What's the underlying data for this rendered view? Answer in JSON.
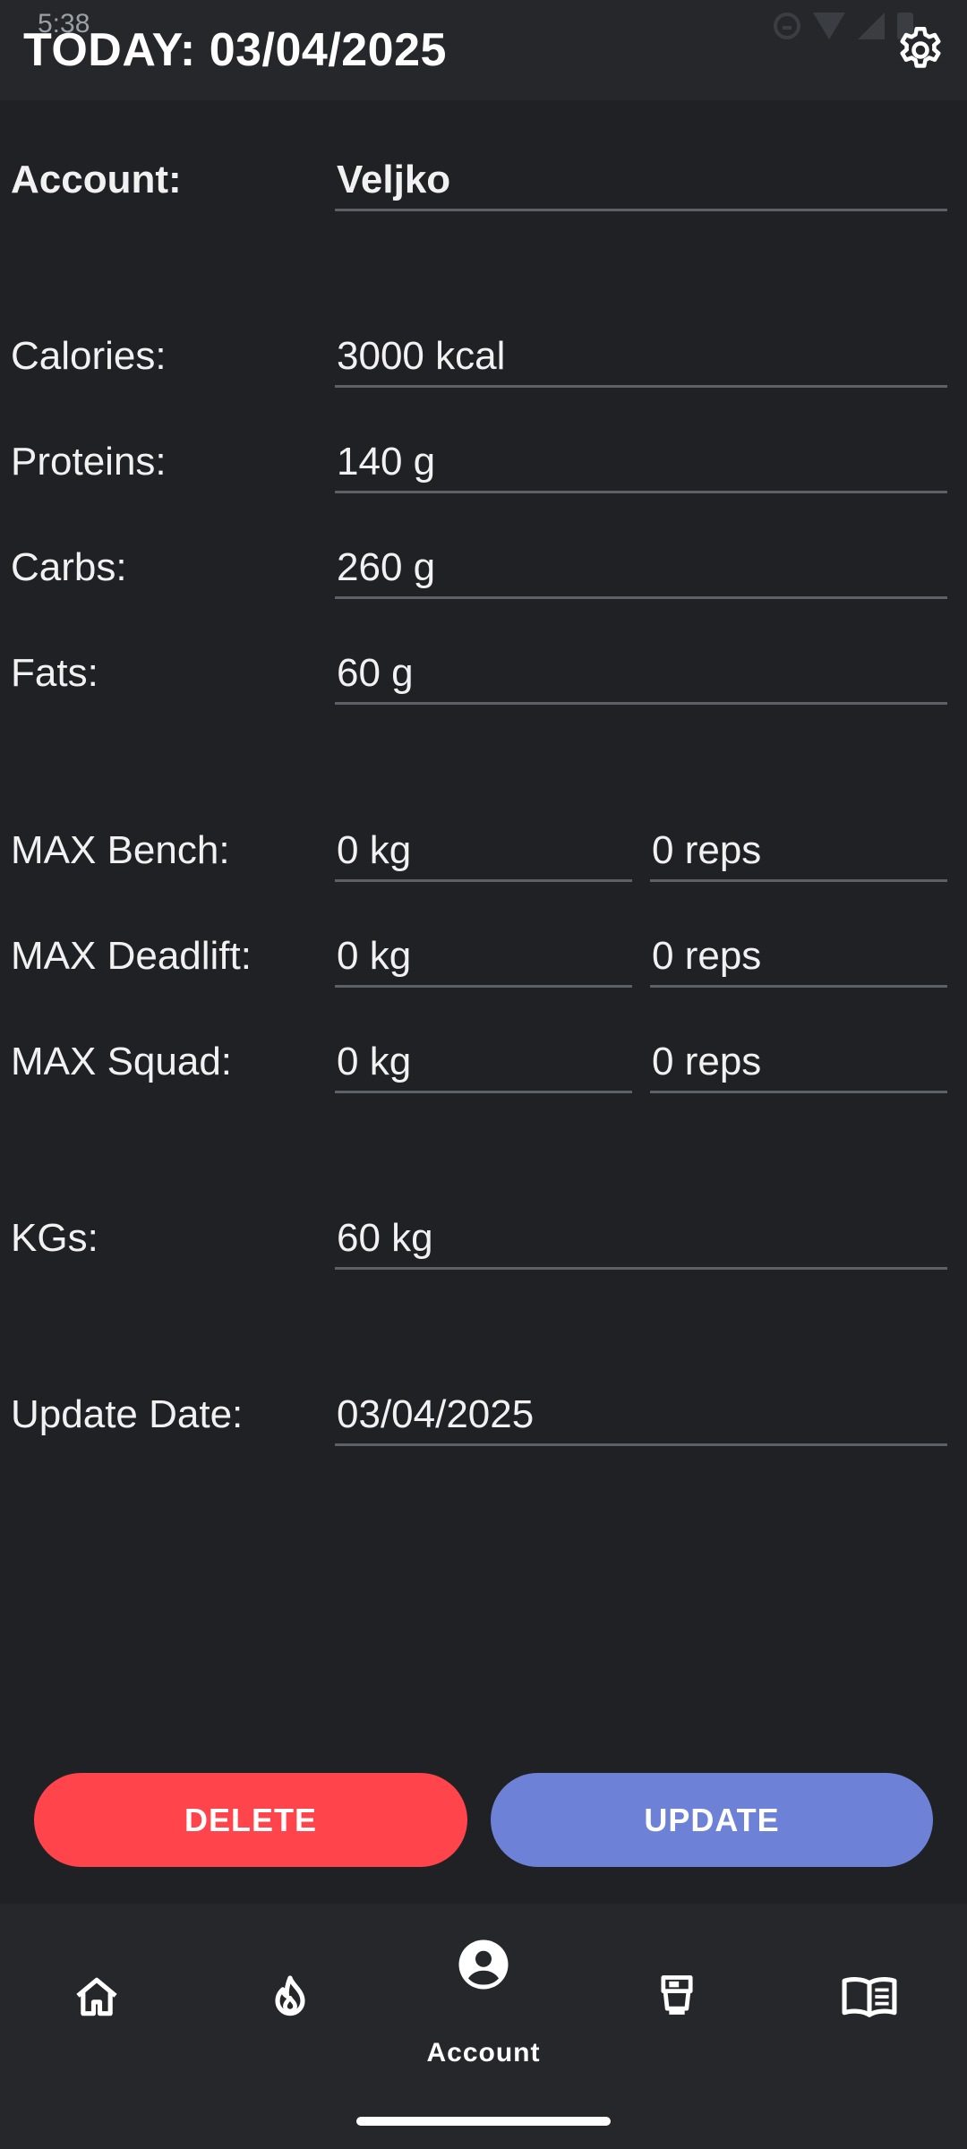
{
  "status_bar": {
    "time": "5:38"
  },
  "header": {
    "title": "TODAY: 03/04/2025"
  },
  "form": {
    "account": {
      "label": "Account:",
      "value": "Veljko"
    },
    "calories": {
      "label": "Calories:",
      "value": "3000 kcal"
    },
    "proteins": {
      "label": "Proteins:",
      "value": "140 g"
    },
    "carbs": {
      "label": "Carbs:",
      "value": "260 g"
    },
    "fats": {
      "label": "Fats:",
      "value": "60 g"
    },
    "max_bench": {
      "label": "MAX Bench:",
      "kg": "0 kg",
      "reps": "0 reps"
    },
    "max_deadlift": {
      "label": "MAX Deadlift:",
      "kg": "0 kg",
      "reps": "0 reps"
    },
    "max_squad": {
      "label": "MAX Squad:",
      "kg": "0 kg",
      "reps": "0 reps"
    },
    "kgs": {
      "label": "KGs:",
      "value": "60 kg"
    },
    "update_date": {
      "label": "Update Date:",
      "value": "03/04/2025"
    }
  },
  "actions": {
    "delete_label": "DELETE",
    "update_label": "UPDATE"
  },
  "bottom_nav": {
    "items": [
      {
        "icon": "home-icon",
        "label": ""
      },
      {
        "icon": "fire-icon",
        "label": ""
      },
      {
        "icon": "account-circle-icon",
        "label": "Account",
        "active": true
      },
      {
        "icon": "food-icon",
        "label": ""
      },
      {
        "icon": "book-icon",
        "label": ""
      }
    ]
  },
  "colors": {
    "background": "#1f2124",
    "header_bg": "#25272b",
    "delete": "#ff444b",
    "update": "#6d82d6",
    "underline": "#5d6066"
  }
}
